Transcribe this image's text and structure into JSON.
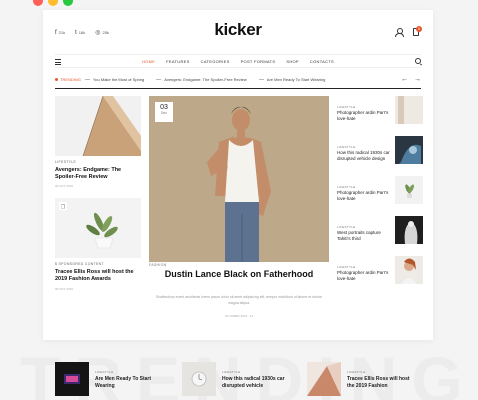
{
  "window": {
    "dot_colors": [
      "#ff5f56",
      "#ffbd2e",
      "#27c93f"
    ]
  },
  "header": {
    "logo": "kicker",
    "socials": [
      {
        "icon": "facebook-icon",
        "glyph": "f",
        "count": "21k"
      },
      {
        "icon": "twitter-icon",
        "glyph": "t",
        "count": "16k"
      },
      {
        "icon": "instagram-icon",
        "glyph": "◎",
        "count": "25k"
      }
    ],
    "cart_count": "0"
  },
  "nav": {
    "items": [
      "HOME",
      "FEATURES",
      "CATEGORIES",
      "POST FORMATS",
      "SHOP",
      "CONTACTS"
    ],
    "active_index": 0
  },
  "trending": {
    "label": "TRENDING",
    "items": [
      "You Make the Most of Spring",
      "Avengers: Endgame: The Spoiler-Free Review",
      "Are Men Ready To Start Wearing"
    ]
  },
  "left": [
    {
      "tag": "LIFESTYLE",
      "title": "Avengers: Endgame: The Spoiler-Free Review",
      "meta": "00 OCT 2019"
    },
    {
      "tag": "SPONSORED CONTENT",
      "title": "Tracee Ellis Ross will host the 2019 Fashion Awards",
      "meta": "00 OCT 2019"
    }
  ],
  "hero": {
    "day": "03",
    "month": "Dec",
    "tag": "FASHION",
    "title": "Dustin Lance Black on Fatherhood",
    "excerpt": "Shaftesbury event architects lorem ipsum dolor sit amet adipiscing elit, tempor incididunt ut labore et dolore magna aliqua.",
    "meta": "OCTOBER 2019 · 12"
  },
  "right": [
    {
      "tag": "LIFESTYLE",
      "title": "Photographer ardin Parr's love-hate"
    },
    {
      "tag": "LIFESTYLE",
      "title": "How this radical 1930s car disrupted vehicle design"
    },
    {
      "tag": "LIFESTYLE",
      "title": "Photographer ardin Parr's love-hate"
    },
    {
      "tag": "LIFESTYLE",
      "title": "West portraits capture Tahiti's third"
    },
    {
      "tag": "LIFESTYLE",
      "title": "Photographer ardin Parr's love-hate"
    }
  ],
  "bottom": {
    "bg_word": "TRENDING",
    "items": [
      {
        "tag": "LIFESTYLE",
        "title": "Are Men Ready To Start Wearing"
      },
      {
        "tag": "LIFESTYLE",
        "title": "How this radical 1930s car disrupted vehicle"
      },
      {
        "tag": "LIFESTYLE",
        "title": "Tracee Ellis Ross will host the 2019 Fashion"
      }
    ]
  },
  "colors": {
    "accent": "#e4582e",
    "hero_bg": "#b9a486"
  }
}
